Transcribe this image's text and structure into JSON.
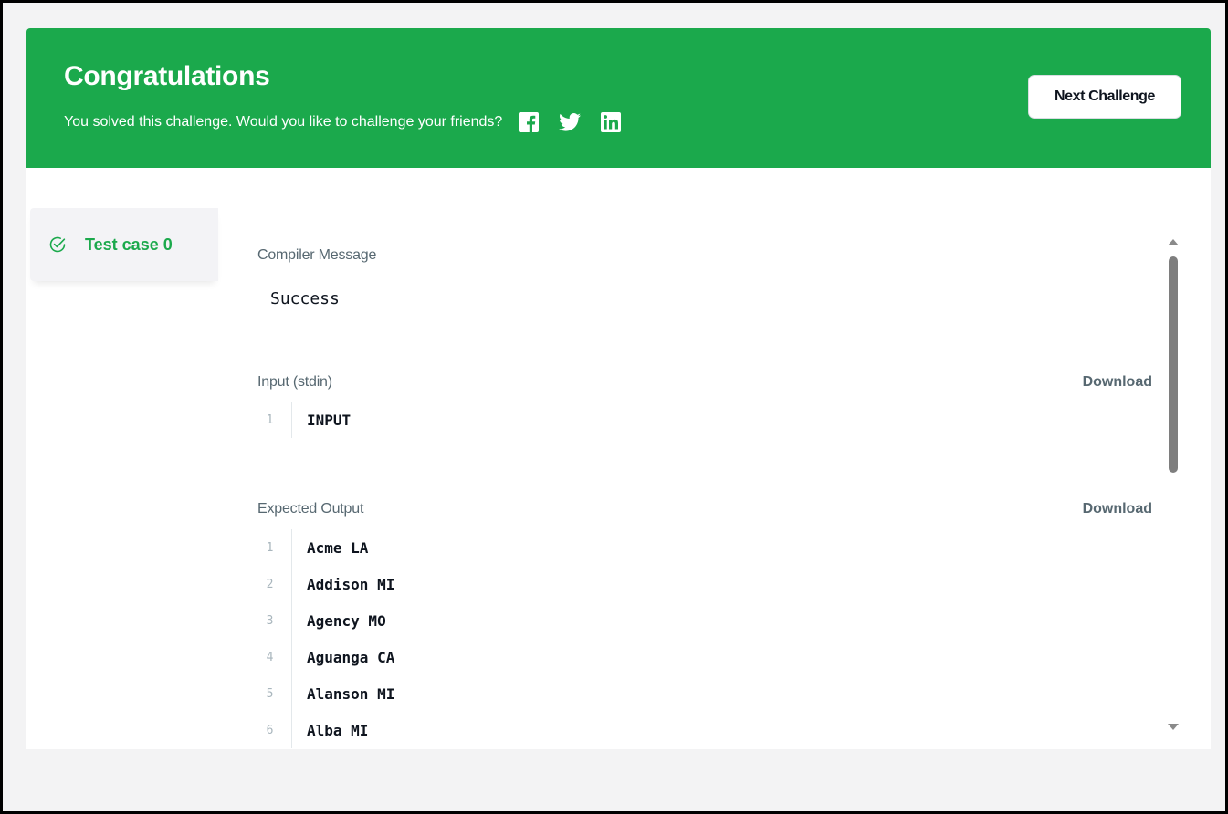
{
  "banner": {
    "title": "Congratulations",
    "subtitle": "You solved this challenge. Would you like to challenge your friends?",
    "next_button_label": "Next Challenge",
    "social_icons": [
      "facebook-icon",
      "twitter-icon",
      "linkedin-icon"
    ],
    "background_color": "#1ba94c"
  },
  "test_cases": [
    {
      "label": "Test case 0",
      "status": "passed",
      "icon": "check-circle-icon"
    }
  ],
  "result": {
    "compiler_message_label": "Compiler Message",
    "compiler_message": "Success",
    "input_label": "Input (stdin)",
    "input_download_label": "Download",
    "input_lines": [
      {
        "no": "1",
        "text": "INPUT"
      }
    ],
    "expected_label": "Expected Output",
    "expected_download_label": "Download",
    "expected_lines": [
      {
        "no": "1",
        "text": "Acme LA"
      },
      {
        "no": "2",
        "text": "Addison MI"
      },
      {
        "no": "3",
        "text": "Agency MO"
      },
      {
        "no": "4",
        "text": "Aguanga CA"
      },
      {
        "no": "5",
        "text": "Alanson MI"
      },
      {
        "no": "6",
        "text": "Alba MI"
      }
    ]
  }
}
